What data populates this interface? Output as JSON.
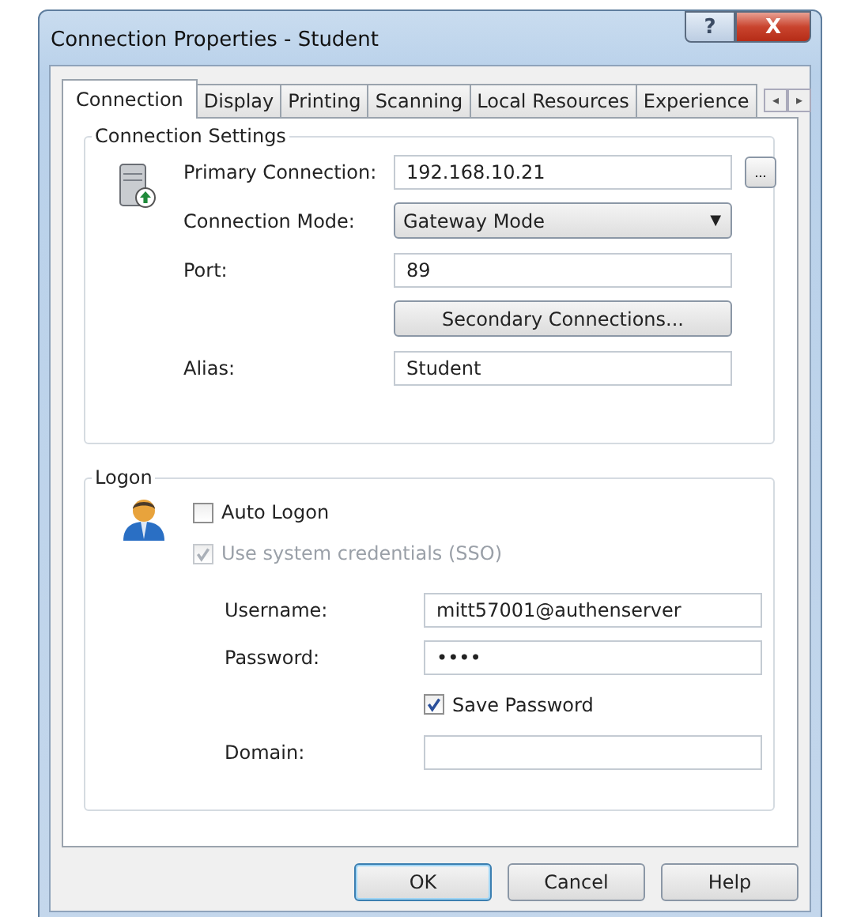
{
  "window": {
    "title": "Connection Properties - Student",
    "help_button": "?",
    "close_button": "X"
  },
  "tabs": [
    {
      "label": "Connection",
      "selected": true
    },
    {
      "label": "Display",
      "selected": false
    },
    {
      "label": "Printing",
      "selected": false
    },
    {
      "label": "Scanning",
      "selected": false
    },
    {
      "label": "Local Resources",
      "selected": false
    },
    {
      "label": "Experience",
      "selected": false
    }
  ],
  "tab_scroll": [
    "◂",
    "▸"
  ],
  "connection_settings": {
    "title": "Connection Settings",
    "rows": [
      {
        "kind": "field",
        "label": "Primary Connection:",
        "value": "192.168.10.21",
        "browse": "..."
      },
      {
        "kind": "dropdown",
        "label": "Connection Mode:",
        "value": "Gateway Mode",
        "caret": "▼"
      },
      {
        "kind": "field",
        "label": "Port:",
        "value": "89"
      },
      {
        "kind": "button",
        "text": "Secondary Connections..."
      },
      {
        "kind": "field",
        "label": "Alias:",
        "value": "Student"
      }
    ]
  },
  "logon": {
    "title": "Logon",
    "options": [
      {
        "label": "Auto Logon",
        "checked": false,
        "disabled": false
      },
      {
        "label": "Use system credentials (SSO)",
        "checked": true,
        "disabled": true
      }
    ],
    "rows": [
      {
        "kind": "field",
        "label": "Username:",
        "value": "mitt57001@authenserver"
      },
      {
        "kind": "field",
        "label": "Password:",
        "value": "••••"
      },
      {
        "kind": "checkbox",
        "label": "Save Password",
        "checked": true,
        "disabled": false
      },
      {
        "kind": "field",
        "label": "Domain:"
      }
    ]
  },
  "buttons": [
    {
      "text": "OK",
      "default": true
    },
    {
      "text": "Cancel",
      "default": false
    },
    {
      "text": "Help",
      "default": false
    }
  ]
}
